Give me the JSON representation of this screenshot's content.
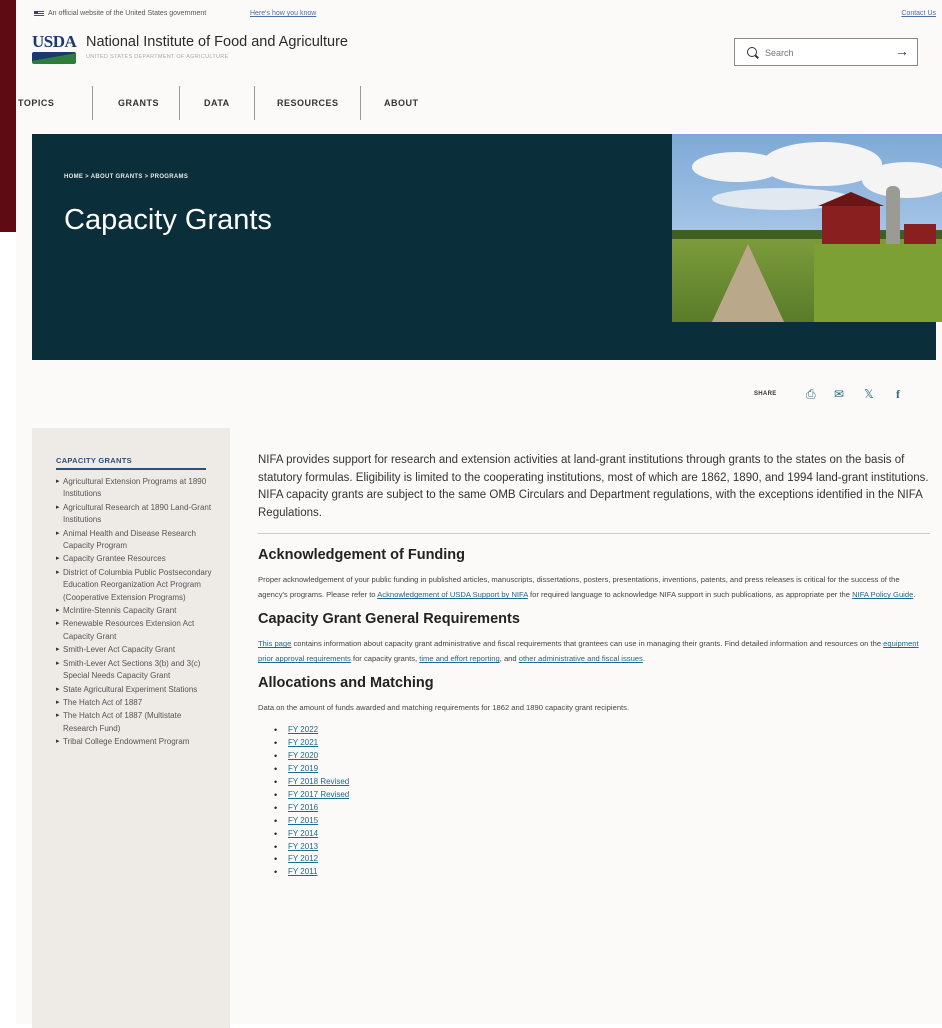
{
  "gov_banner": {
    "text": "An official website of the United States government",
    "how_link": "Here's how you know",
    "contact": "Contact Us"
  },
  "header": {
    "logo_text": "USDA",
    "site_name": "National Institute of Food and Agriculture",
    "site_sub": "UNITED STATES DEPARTMENT OF AGRICULTURE",
    "search_placeholder": "Search",
    "search_go": "→"
  },
  "nav": [
    "TOPICS",
    "GRANTS",
    "DATA",
    "RESOURCES",
    "ABOUT"
  ],
  "hero": {
    "breadcrumb": "HOME  >  ABOUT GRANTS  >  PROGRAMS",
    "title": "Capacity Grants"
  },
  "share": {
    "label": "SHARE",
    "icons": [
      "print-icon",
      "email-icon",
      "x-icon",
      "facebook-icon"
    ]
  },
  "sidebar": {
    "heading": "CAPACITY GRANTS",
    "items": [
      "Agricultural Extension Programs at 1890 Institutions",
      "Agricultural Research at 1890 Land-Grant Institutions",
      "Animal Health and Disease Research Capacity Program",
      "Capacity Grantee Resources",
      "District of Columbia Public Postsecondary Education Reorganization Act Program (Cooperative Extension Programs)",
      "McIntire-Stennis Capacity Grant",
      "Renewable Resources Extension Act Capacity Grant",
      "Smith-Lever Act Capacity Grant",
      "Smith-Lever Act Sections 3(b) and 3(c) Special Needs Capacity Grant",
      "State Agricultural Experiment Stations",
      "The Hatch Act of 1887",
      "The Hatch Act of 1887 (Multistate Research Fund)",
      "Tribal College Endowment Program"
    ]
  },
  "main": {
    "intro": "NIFA provides support for research and extension activities at land-grant institutions through grants to the states on the basis of statutory formulas. Eligibility is limited to the cooperating institutions, most of which are 1862, 1890, and 1994 land-grant institutions. NIFA capacity grants are subject to the same OMB Circulars and Department regulations, with the exceptions identified in the NIFA Regulations.",
    "ack": {
      "heading": "Acknowledgement of Funding",
      "text_a": "Proper acknowledgement of your public funding in published articles, manuscripts, dissertations, posters, presentations, inventions, patents, and press releases is critical for the success of the agency's programs. Please refer to ",
      "link_a": "Acknowledgement of USDA Support by NIFA",
      "text_b": " for required language to acknowledge NIFA support in such publications, as appropriate per the ",
      "link_b": "NIFA Policy Guide",
      "text_c": "."
    },
    "req": {
      "heading": "Capacity Grant General Requirements",
      "link_a": "This page",
      "text_a": " contains information about capacity grant administrative and fiscal requirements that grantees can use in managing their grants. Find detailed information and resources on the ",
      "link_b": "equipment prior approval requirements",
      "text_b": " for capacity grants, ",
      "link_c": "time and effort reporting",
      "text_c": ", and ",
      "link_d": "other administrative and fiscal issues",
      "text_d": "."
    },
    "alloc": {
      "heading": "Allocations and Matching",
      "text": "Data on the amount of funds awarded and matching requirements for 1862 and 1890 capacity grant recipients.",
      "years": [
        "FY 2022",
        "FY 2021",
        "FY 2020",
        "FY 2019",
        "FY 2018 Revised",
        "FY 2017 Revised",
        "FY 2016",
        "FY 2015",
        "FY 2014",
        "FY 2013",
        "FY 2012",
        "FY 2011"
      ]
    }
  }
}
